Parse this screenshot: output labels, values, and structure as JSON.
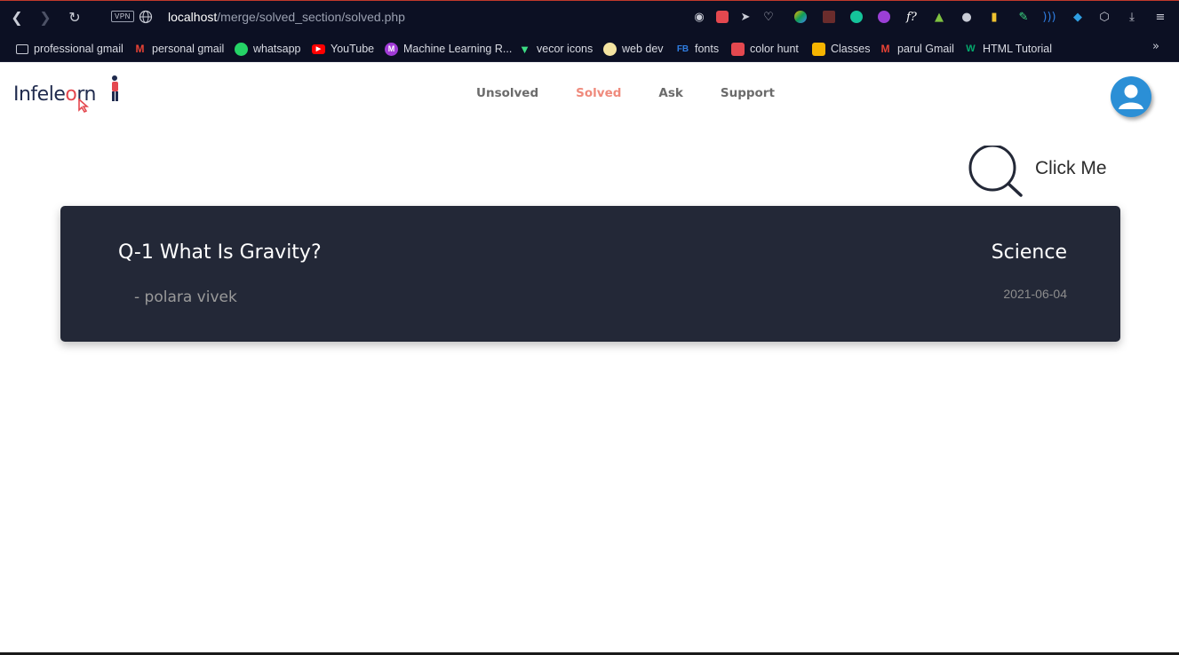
{
  "browser": {
    "vpn_label": "VPN",
    "url_host": "localhost",
    "url_path": "/merge/solved_section/solved.php",
    "bookmarks": [
      {
        "label": "professional gmail",
        "icon": "folder-icon",
        "color": "#c9ccd6"
      },
      {
        "label": "personal gmail",
        "icon": "gmail-icon",
        "color": "#ea4335"
      },
      {
        "label": "whatsapp",
        "icon": "whatsapp-icon",
        "color": "#25d366"
      },
      {
        "label": "YouTube",
        "icon": "youtube-icon",
        "color": "#ff0000"
      },
      {
        "label": "Machine Learning R...",
        "icon": "m-icon",
        "color": "#a13bd6"
      },
      {
        "label": "vecor icons",
        "icon": "vector-icon",
        "color": "#3ddc84"
      },
      {
        "label": "web dev",
        "icon": "webdev-icon",
        "color": "#f4e4a1"
      },
      {
        "label": "fonts",
        "icon": "fonts-icon",
        "color": "#2f7de1"
      },
      {
        "label": "color hunt",
        "icon": "colorhunt-icon",
        "color": "#e4484f"
      },
      {
        "label": "Classes",
        "icon": "classroom-icon",
        "color": "#f6b400"
      },
      {
        "label": "parul Gmail",
        "icon": "gmail-icon",
        "color": "#ea4335"
      },
      {
        "label": "HTML Tutorial",
        "icon": "w3-icon",
        "color": "#04aa6d"
      }
    ]
  },
  "site": {
    "logo_text_a": "Infele",
    "logo_text_o": "o",
    "logo_text_b": "rn",
    "nav": [
      {
        "label": "Unsolved",
        "active": false
      },
      {
        "label": "Solved",
        "active": true
      },
      {
        "label": "Ask",
        "active": false
      },
      {
        "label": "Support",
        "active": false
      }
    ],
    "accent_color": "#ef8a7c"
  },
  "search": {
    "label": "Click Me"
  },
  "questions": [
    {
      "title": "Q-1 What Is Gravity?",
      "author": "- polara vivek",
      "category": "Science",
      "date": "2021-06-04"
    }
  ]
}
